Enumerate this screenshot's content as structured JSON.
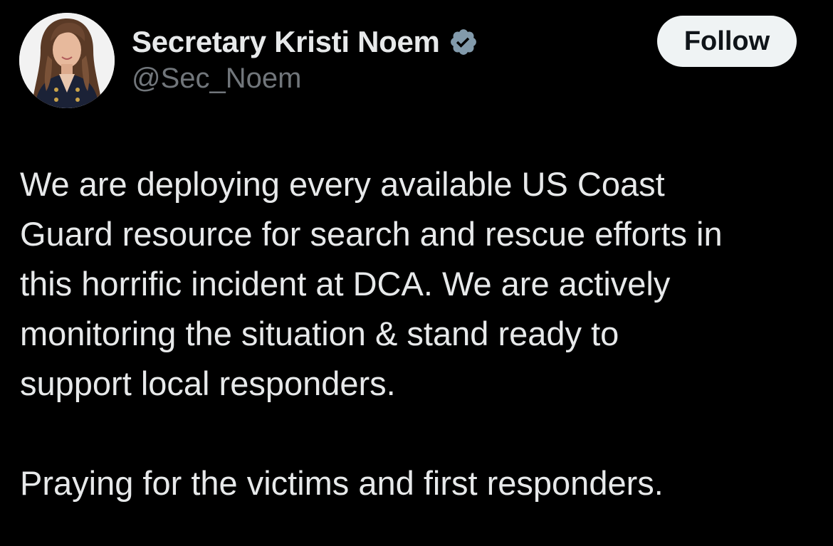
{
  "author": {
    "display_name": "Secretary Kristi Noem",
    "handle": "@Sec_Noem",
    "verified_icon": "verified-badge-icon",
    "badge_color": "#829aab",
    "avatar": "profile-photo"
  },
  "actions": {
    "follow_label": "Follow"
  },
  "post": {
    "paragraph_1": "We are deploying every available US Coast\nGuard resource for search and rescue efforts in\nthis horrific incident at DCA. We are actively\nmonitoring the situation & stand ready to\nsupport local responders.",
    "paragraph_2": "Praying for the victims and first responders."
  },
  "colors": {
    "background": "#000000",
    "primary_text": "#e7e9ea",
    "secondary_text": "#71767b",
    "follow_button_bg": "#eff3f4",
    "follow_button_text": "#0f1419"
  }
}
